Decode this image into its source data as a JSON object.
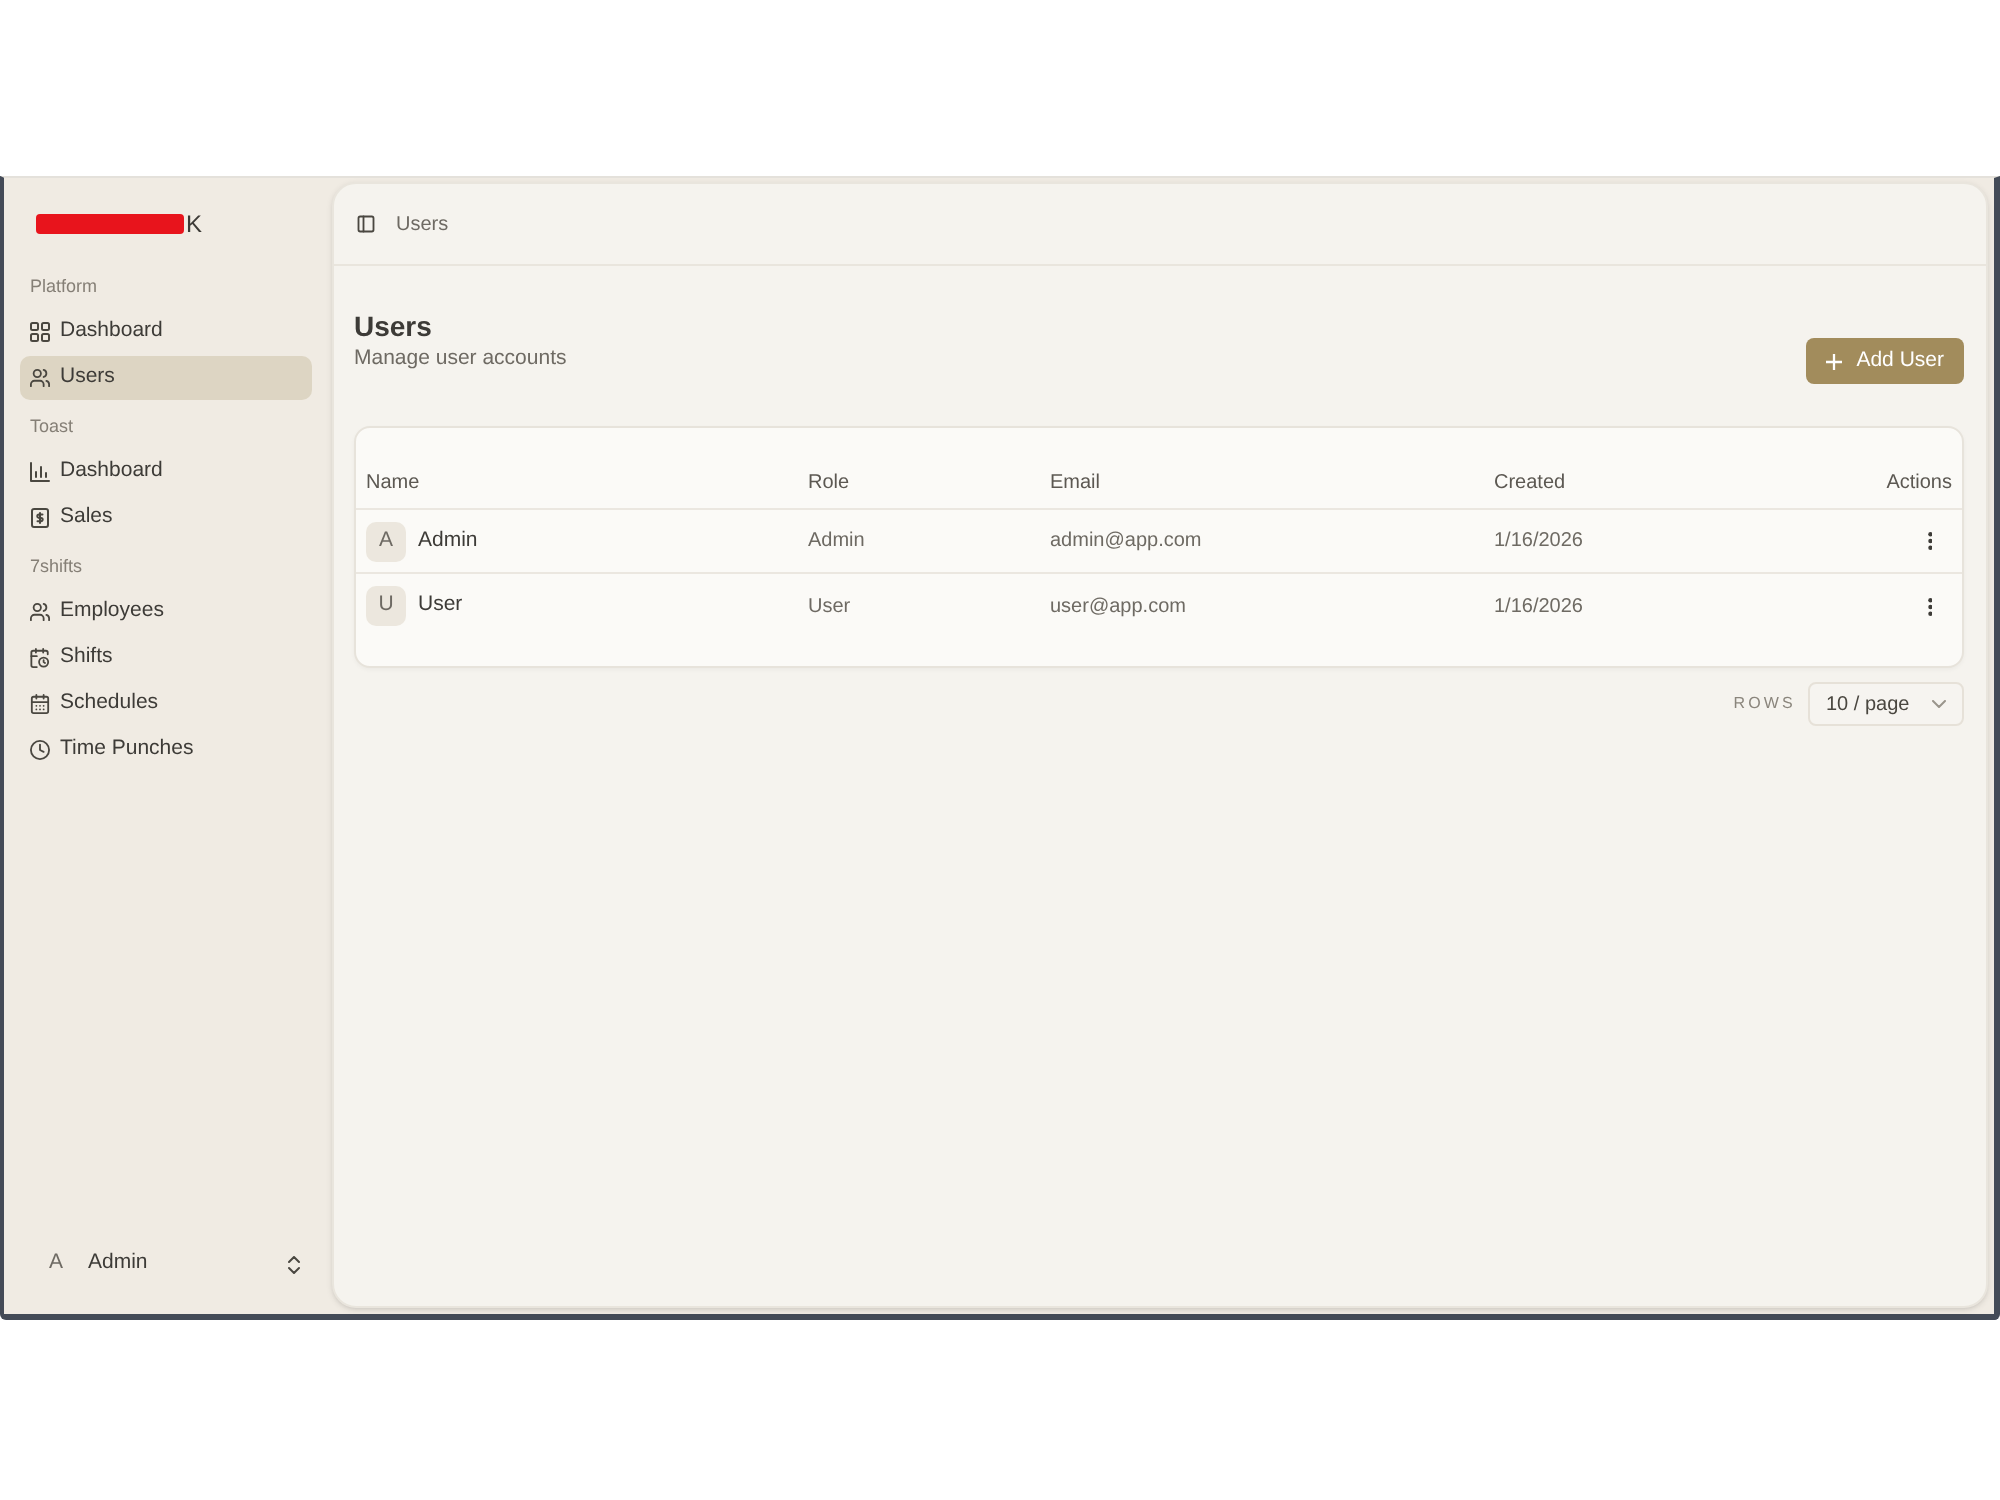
{
  "sidebar": {
    "logo_text": "K",
    "groups": [
      {
        "label": "Platform",
        "items": [
          {
            "label": "Dashboard",
            "selected": false
          },
          {
            "label": "Users",
            "selected": true
          }
        ]
      },
      {
        "label": "Toast",
        "items": [
          {
            "label": "Dashboard",
            "selected": false
          },
          {
            "label": "Sales",
            "selected": false
          }
        ]
      },
      {
        "label": "7shifts",
        "items": [
          {
            "label": "Employees",
            "selected": false
          },
          {
            "label": "Shifts",
            "selected": false
          },
          {
            "label": "Schedules",
            "selected": false
          },
          {
            "label": "Time Punches",
            "selected": false
          }
        ]
      }
    ],
    "user": {
      "initial": "A",
      "name": "Admin"
    }
  },
  "header": {
    "breadcrumb": "Users"
  },
  "page": {
    "title": "Users",
    "subtitle": "Manage user accounts",
    "add_button": "Add User"
  },
  "table": {
    "columns": [
      "Name",
      "Role",
      "Email",
      "Created",
      "Actions"
    ],
    "rows": [
      {
        "initial": "A",
        "name": "Admin",
        "role": "Admin",
        "email": "admin@app.com",
        "created": "1/16/2026"
      },
      {
        "initial": "U",
        "name": "User",
        "role": "User",
        "email": "user@app.com",
        "created": "1/16/2026"
      }
    ]
  },
  "pagination": {
    "label": "ROWS",
    "page_size": "10 / page"
  }
}
